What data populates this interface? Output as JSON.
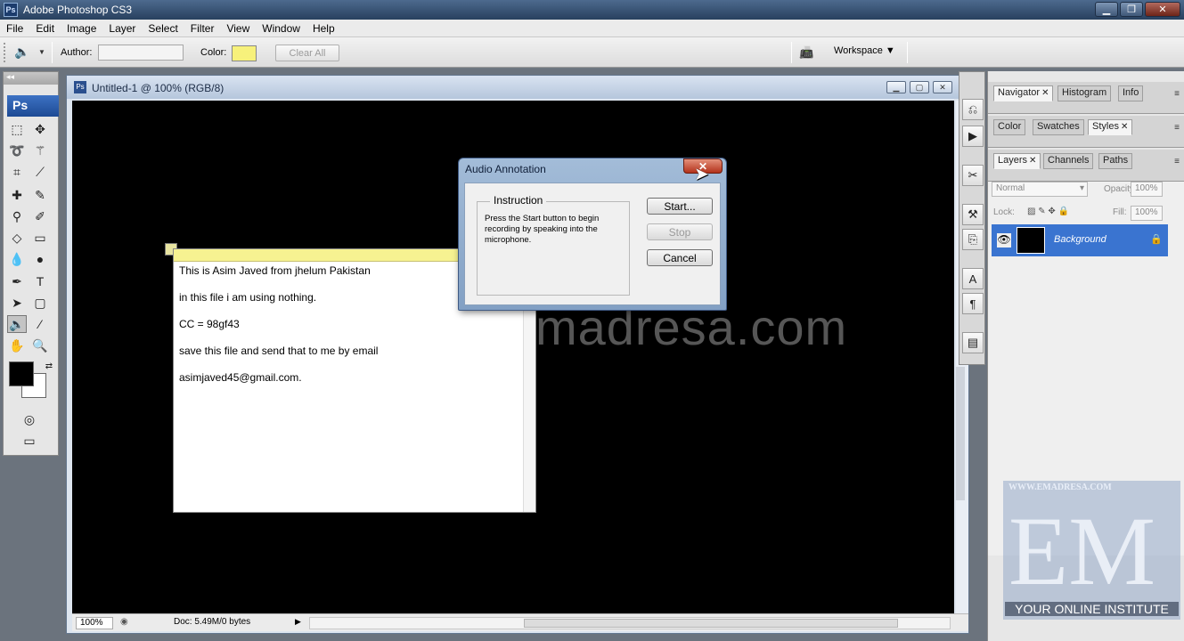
{
  "app": {
    "title": "Adobe Photoshop CS3",
    "logo": "Ps"
  },
  "window_controls": [
    "minimize",
    "restore",
    "close"
  ],
  "menu": [
    "File",
    "Edit",
    "Image",
    "Layer",
    "Select",
    "Filter",
    "View",
    "Window",
    "Help"
  ],
  "options": {
    "author_label": "Author:",
    "author_value": "",
    "color_label": "Color:",
    "color_value": "#f7f17b",
    "clear_all": "Clear All",
    "workspace": "Workspace"
  },
  "toolbox": {
    "badge": "Ps"
  },
  "document": {
    "title": "Untitled-1 @ 100% (RGB/8)",
    "zoom": "100%",
    "doc_info": "Doc: 5.49M/0 bytes",
    "canvas_watermark": "www.emadresa.com"
  },
  "note": {
    "lines": [
      "This is Asim Javed from jhelum Pakistan",
      "in this file i am using nothing.",
      "CC = 98gf43",
      "save this file and send that to me by email",
      "asimjaved45@gmail.com."
    ]
  },
  "dialog": {
    "title": "Audio Annotation",
    "group_label": "Instruction",
    "instruction": "Press the Start button to begin recording by speaking into the microphone.",
    "start": "Start...",
    "stop": "Stop",
    "cancel": "Cancel"
  },
  "panels": {
    "group1_tabs": [
      "Navigator",
      "Histogram",
      "Info"
    ],
    "group2_tabs": [
      "Color",
      "Swatches",
      "Styles"
    ],
    "group3_tabs": [
      "Layers",
      "Channels",
      "Paths"
    ],
    "blend_mode": "Normal",
    "opacity_label": "Opacity:",
    "opacity": "100%",
    "lock_label": "Lock:",
    "fill_label": "Fill:",
    "fill": "100%",
    "layer_name": "Background"
  },
  "logo": {
    "top_text": "WWW.EMADRESA.COM",
    "letters": "EM",
    "subtitle": "YOUR ONLINE INSTITUTE"
  }
}
